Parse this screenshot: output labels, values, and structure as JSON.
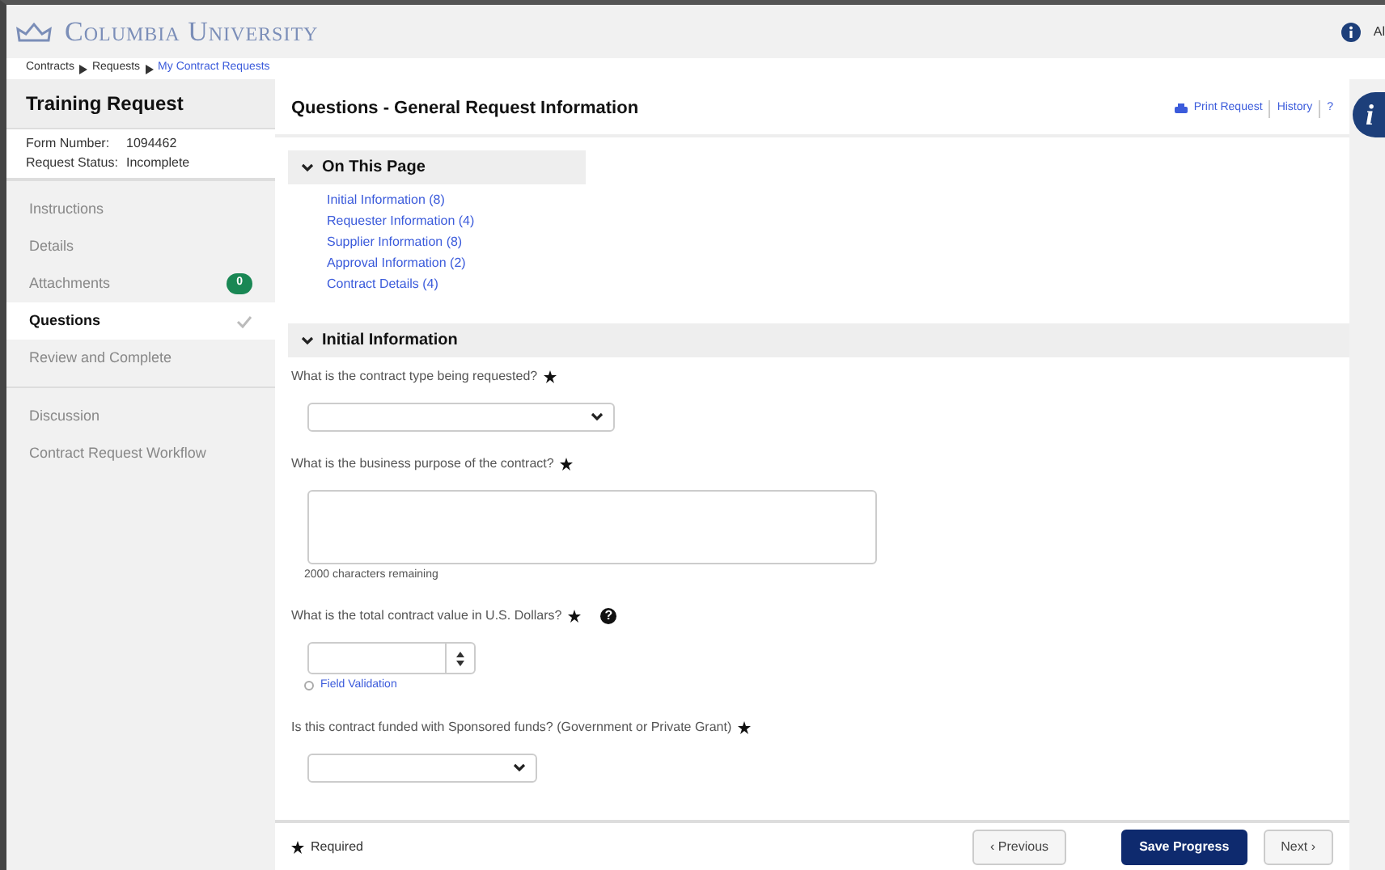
{
  "header": {
    "logo": "Columbia University",
    "user": "Al"
  },
  "breadcrumb": [
    {
      "label": "Contracts",
      "link": false
    },
    {
      "label": "Requests",
      "link": false
    },
    {
      "label": "My Contract Requests",
      "link": true
    }
  ],
  "sidebar": {
    "title": "Training Request",
    "meta": [
      {
        "label": "Form Number:",
        "value": "1094462"
      },
      {
        "label": "Request Status:",
        "value": "Incomplete"
      }
    ],
    "groups": [
      [
        {
          "label": "Instructions",
          "selected": false
        },
        {
          "label": "Details",
          "selected": false
        },
        {
          "label": "Attachments",
          "selected": false,
          "badge": "0"
        },
        {
          "label": "Questions",
          "selected": true,
          "done": true
        },
        {
          "label": "Review and Complete",
          "selected": false
        }
      ],
      [
        {
          "label": "Discussion",
          "selected": false
        },
        {
          "label": "Contract Request Workflow",
          "selected": false
        }
      ]
    ]
  },
  "page": {
    "title": "Questions - General Request Information",
    "actions": [
      "Print Request",
      "History",
      "?"
    ]
  },
  "on_this_page": {
    "title": "On This Page",
    "links": [
      "Initial Information (8)",
      "Requester Information (4)",
      "Supplier Information (8)",
      "Approval Information (2)",
      "Contract Details (4)"
    ]
  },
  "section": {
    "title": "Initial Information"
  },
  "questions": [
    {
      "kind": "select",
      "label": "What is the contract type being requested?",
      "required": true
    },
    {
      "kind": "textarea",
      "label": "What is the business purpose of the contract?",
      "required": true,
      "note": "2000 characters remaining"
    },
    {
      "kind": "number",
      "label": "What is the total contract value in U.S. Dollars?",
      "required": true,
      "help": "?",
      "link": "Field Validation"
    },
    {
      "kind": "select",
      "label": "Is this contract funded with Sponsored funds? (Government or Private Grant)",
      "required": true
    }
  ],
  "footer": {
    "legend": "Required",
    "buttons": [
      {
        "kind": "prev",
        "label": "‹ Previous"
      },
      {
        "kind": "primary",
        "label": "Save Progress"
      },
      {
        "kind": "next",
        "label": "Next ›"
      }
    ]
  },
  "side_panel": {
    "info_button": "i"
  }
}
